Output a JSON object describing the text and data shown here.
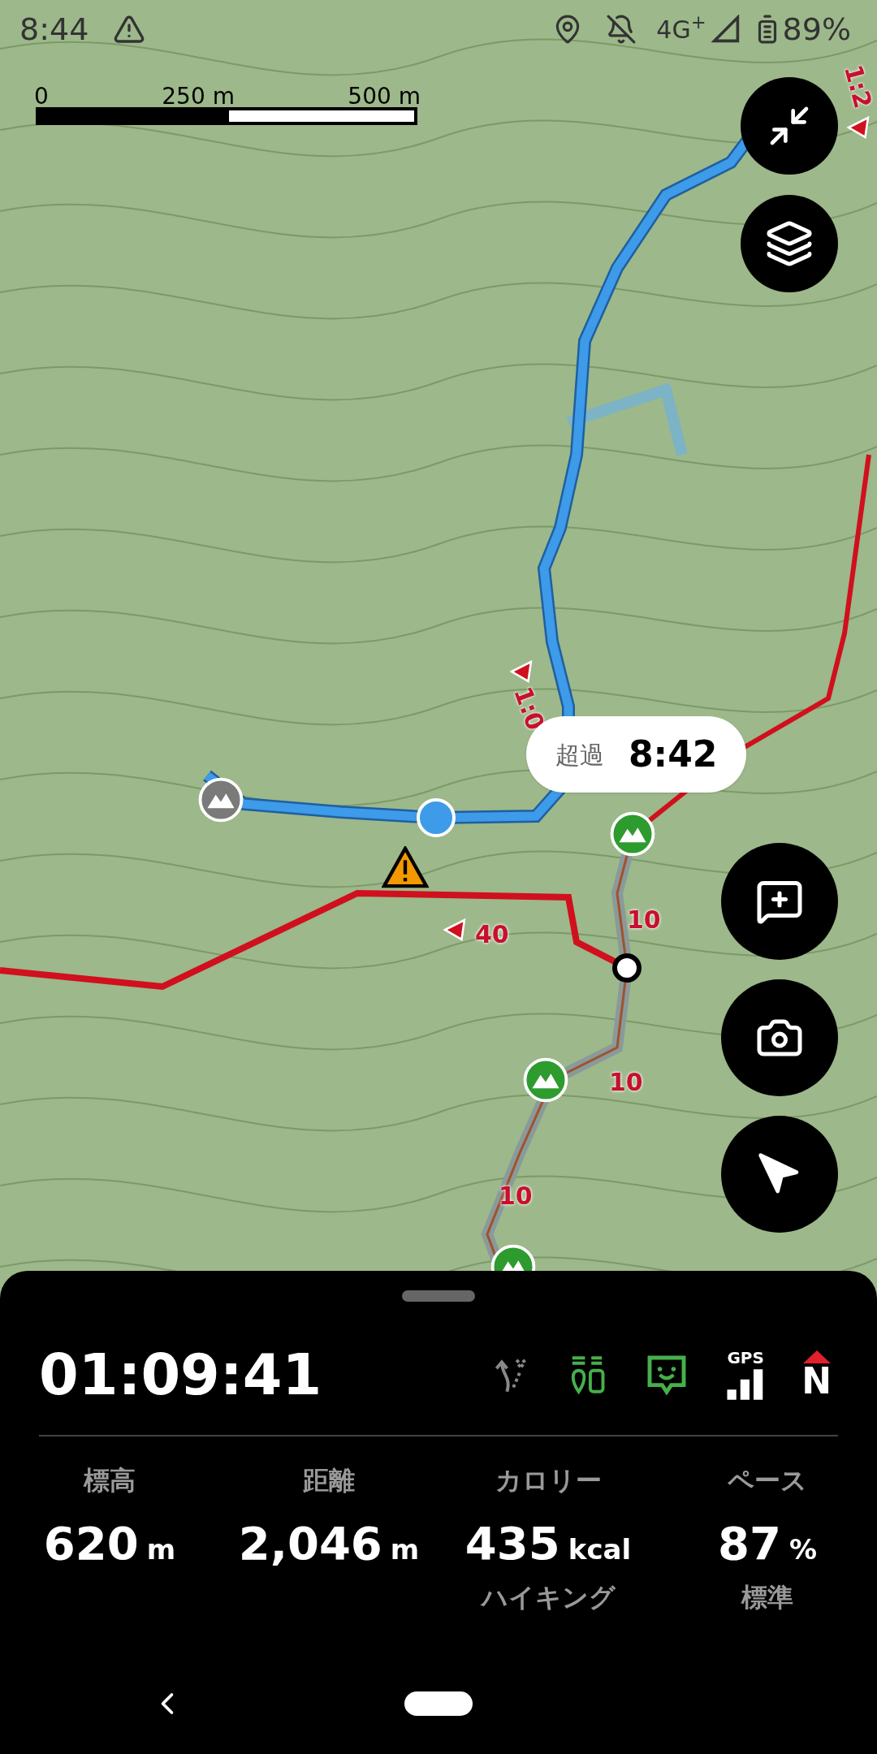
{
  "status_bar": {
    "time": "8:44",
    "network": "4G$^{+}$",
    "battery": "89%"
  },
  "map": {
    "scale_labels": [
      "0",
      "250 m",
      "500 m"
    ],
    "route_labels": [
      {
        "text": "1:2"
      },
      {
        "text": "1:0"
      },
      {
        "text": "40"
      },
      {
        "text": "10"
      },
      {
        "text": "10"
      },
      {
        "text": "10"
      }
    ],
    "callout": {
      "label": "超過",
      "value": "8:42"
    }
  },
  "panel": {
    "elapsed": "01:09:41",
    "gps_label": "GPS",
    "compass_label": "N",
    "stats": [
      {
        "label": "標高",
        "value": "620",
        "unit": "m"
      },
      {
        "label": "距離",
        "value": "2,046",
        "unit": "m"
      },
      {
        "label": "カロリー",
        "value": "435",
        "unit": "kcal",
        "sub": "ハイキング"
      },
      {
        "label": "ペース",
        "value": "87",
        "unit": "%",
        "sub": "標準"
      }
    ]
  }
}
